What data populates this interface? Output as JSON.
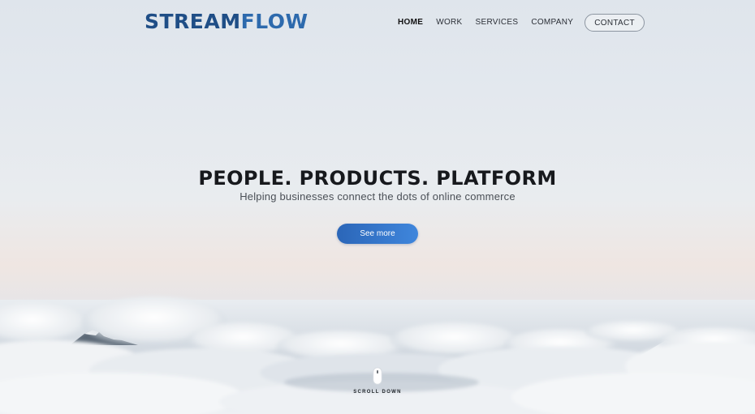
{
  "header": {
    "logo_part_a": "STREAM",
    "logo_part_b": "FLOW",
    "nav": [
      {
        "label": "HOME",
        "active": true
      },
      {
        "label": "WORK",
        "active": false
      },
      {
        "label": "SERVICES",
        "active": false
      },
      {
        "label": "COMPANY",
        "active": false
      }
    ],
    "contact_label": "CONTACT"
  },
  "hero": {
    "title": "PEOPLE. PRODUCTS. PLATFORM",
    "subtitle": "Helping businesses connect the dots of online commerce",
    "cta_label": "See more"
  },
  "scroll": {
    "label": "SCROLL DOWN",
    "icon": "mouse-icon"
  },
  "colors": {
    "logo_dark": "#1f4e86",
    "logo_light": "#2d6aad",
    "button_start": "#2b66b8",
    "button_end": "#3f86dc",
    "text_dark": "#17191d"
  }
}
